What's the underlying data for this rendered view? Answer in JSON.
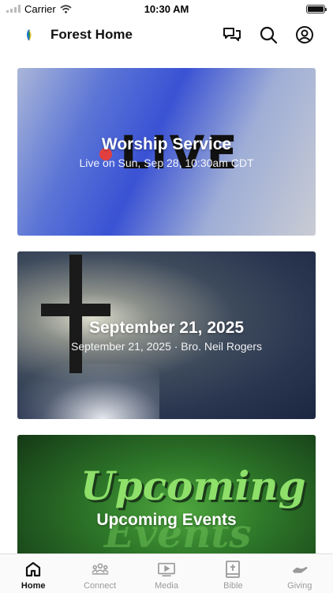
{
  "status": {
    "carrier": "Carrier",
    "time": "10:30 AM"
  },
  "header": {
    "title": "Forest Home"
  },
  "cards": [
    {
      "title": "Worship Service",
      "subtitle": "Live on Sun, Sep 28, 10:30am CDT",
      "art_text": "LIVE"
    },
    {
      "title": "September 21, 2025",
      "subtitle": "September 21, 2025 · Bro. Neil Rogers"
    },
    {
      "title": "Upcoming Events",
      "art_text_1": "Upcoming",
      "art_text_2": "Events"
    }
  ],
  "tabs": [
    {
      "label": "Home",
      "icon": "home-icon",
      "active": true
    },
    {
      "label": "Connect",
      "icon": "people-icon",
      "active": false
    },
    {
      "label": "Media",
      "icon": "play-icon",
      "active": false
    },
    {
      "label": "Bible",
      "icon": "bible-icon",
      "active": false
    },
    {
      "label": "Giving",
      "icon": "giving-icon",
      "active": false
    }
  ],
  "colors": {
    "active_tab": "#111111",
    "inactive_tab": "#9a9a9a",
    "live_dot": "#e24040"
  }
}
